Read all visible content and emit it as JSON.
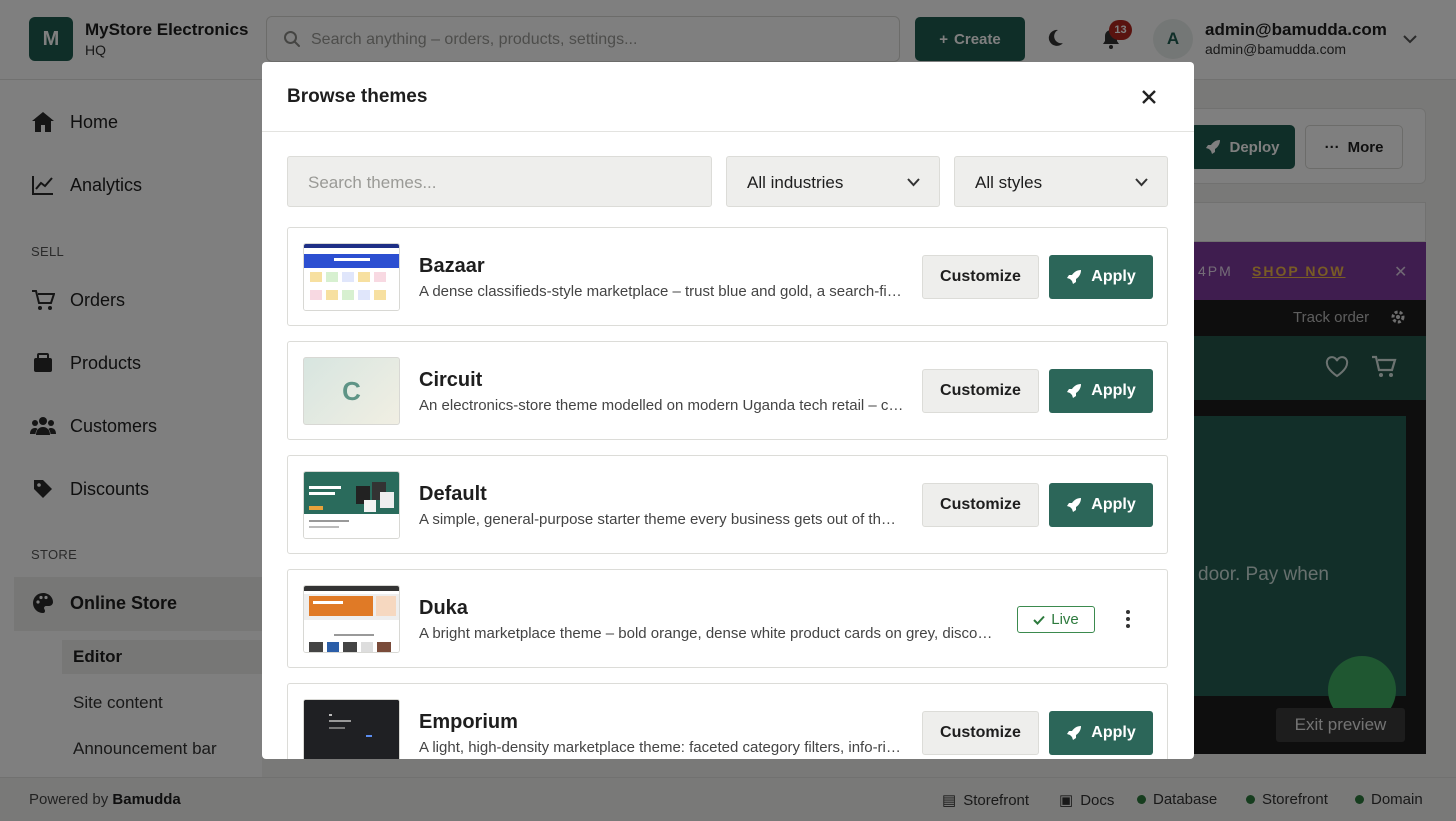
{
  "app": {
    "logo_letter": "M",
    "store_name": "MyStore Electronics",
    "store_sub": "HQ"
  },
  "topbar": {
    "search_placeholder": "Search anything – orders, products, settings...",
    "create_label": "Create",
    "notification_count": "13",
    "avatar_letter": "A",
    "user_email": "admin@bamudda.com",
    "user_sub": "admin@bamudda.com"
  },
  "sidebar": {
    "items": [
      {
        "label": "Home",
        "icon": "home-icon"
      },
      {
        "label": "Analytics",
        "icon": "analytics-icon"
      }
    ],
    "sell_label": "SELL",
    "sell_items": [
      {
        "label": "Orders",
        "icon": "cart-icon"
      },
      {
        "label": "Products",
        "icon": "box-icon"
      },
      {
        "label": "Customers",
        "icon": "users-icon"
      },
      {
        "label": "Discounts",
        "icon": "tag-icon"
      }
    ],
    "store_label": "STORE",
    "store_item": {
      "label": "Online Store",
      "icon": "palette-icon"
    },
    "sub_items": [
      "Editor",
      "Site content",
      "Announcement bar"
    ]
  },
  "preview": {
    "deploy_label": "Deploy",
    "more_label": "More",
    "promo_time": "4PM",
    "promo_shop": "SHOP NOW",
    "track_order": "Track order",
    "hero_text": "door. Pay when",
    "exit_label": "Exit preview"
  },
  "footer": {
    "powered_prefix": "Powered by",
    "powered_brand": "Bamudda",
    "links": [
      {
        "label": "Storefront",
        "icon": "store-icon"
      },
      {
        "label": "Docs",
        "icon": "book-icon"
      }
    ],
    "status": [
      {
        "label": "Database",
        "color": "#2d7a3d"
      },
      {
        "label": "Storefront",
        "color": "#2d7a3d"
      },
      {
        "label": "Domain",
        "color": "#2d7a3d"
      }
    ]
  },
  "modal": {
    "title": "Browse themes",
    "search_placeholder": "Search themes...",
    "industry_filter": "All industries",
    "style_filter": "All styles",
    "customize_label": "Customize",
    "apply_label": "Apply",
    "live_label": "Live",
    "themes": [
      {
        "name": "Bazaar",
        "desc": "A dense classifieds-style marketplace – trust blue and gold, a search-first header and category grid."
      },
      {
        "name": "Circuit",
        "desc": "An electronics-store theme modelled on modern Uganda tech retail – clean cards and spec-first layouts.",
        "thumb_letter": "C"
      },
      {
        "name": "Default",
        "desc": "A simple, general-purpose starter theme every business gets out of the box."
      },
      {
        "name": "Duka",
        "desc": "A bright marketplace theme – bold orange, dense white product cards on grey, discount badges.",
        "live": true
      },
      {
        "name": "Emporium",
        "desc": "A light, high-density marketplace theme: faceted category filters, info-rich product cards."
      }
    ]
  },
  "colors": {
    "brand": "#1f5c50",
    "apply": "#2c6659",
    "badge": "#b3261e",
    "promo": "#7e3a9e",
    "live": "#2d7a3d"
  }
}
